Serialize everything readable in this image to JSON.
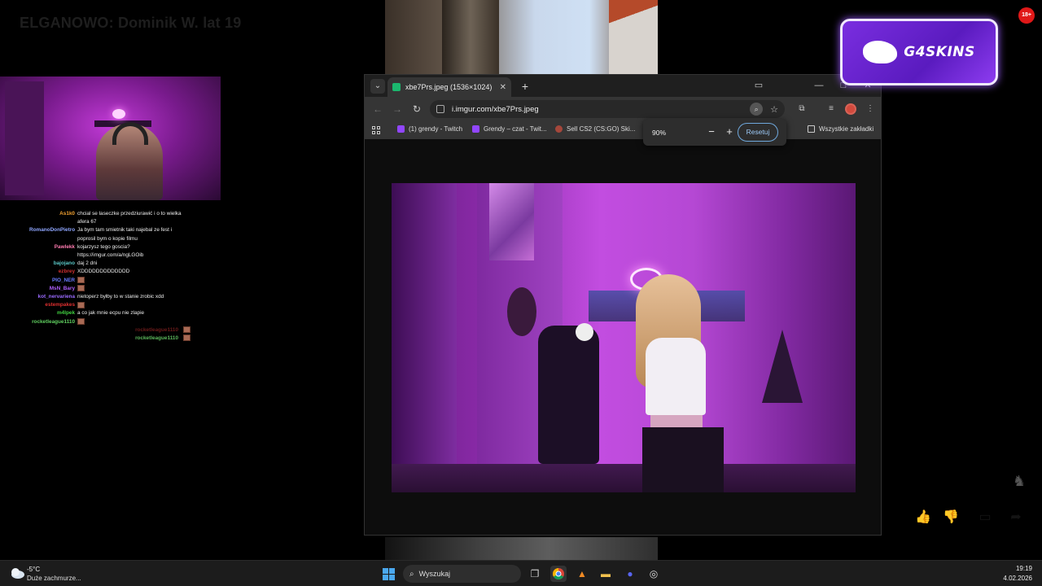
{
  "stream": {
    "title": "ELGANOWO: Dominik W. lat 19"
  },
  "chat": [
    {
      "user": "As1k0",
      "color": "#f0a030",
      "message": "chcial se laseczke przedziurawić i o to wielka afera 67"
    },
    {
      "user": "RomanoDonPietro",
      "color": "#8fa6ff",
      "message": "Ja bym tam smietnik taki najebal ze fest i poprosil bym o kopie filmu"
    },
    {
      "user": "Pawlekk",
      "color": "#ff7bb0",
      "message": "kojarzysz tego goscia? https://imgur.com/a/ngLGOib"
    },
    {
      "user": "bajojano",
      "color": "#5ac8c8",
      "message": "daj 2 dni"
    },
    {
      "user": "ezbrey",
      "color": "#d03030",
      "message": "XDDDDDDDDDDDDD"
    },
    {
      "user": "PIO_NER",
      "color": "#6a7bff",
      "message": "",
      "emote": true
    },
    {
      "user": "MsN_Bary",
      "color": "#b060ff",
      "message": "",
      "emote": true
    },
    {
      "user": "kot_nervariena",
      "color": "#9b6bff",
      "message": "nietoperz byłby to w stanie zrobic xdd"
    },
    {
      "user": "estempakes",
      "color": "#e03030",
      "message": "",
      "emote": true
    },
    {
      "user": "m4lpek",
      "color": "#40d040",
      "message": "a co jak mnie ecpu nie zlapie"
    },
    {
      "user": "rocketleague1110",
      "color": "#60d060",
      "message": "",
      "emote": true
    }
  ],
  "chat_right": [
    {
      "user": "rocketleague1110",
      "color": "#6b1a1a"
    },
    {
      "user": "rocketleague1110",
      "color": "#5cb85c"
    }
  ],
  "browser": {
    "tab_title": "xbe7Prs.jpeg (1536×1024)",
    "url": "i.imgur.com/xbe7Prs.jpeg",
    "bookmarks": [
      {
        "label": "(1) grendy - Twitch",
        "icon": "twitch-icon"
      },
      {
        "label": "Grendy – czat - Twit...",
        "icon": "twitch-icon"
      },
      {
        "label": "Sell CS2 (CS:GO) Ski...",
        "icon": "sell-icon"
      },
      {
        "label": "Wszystkie zakładki",
        "icon": "folder-icon"
      }
    ],
    "zoom": {
      "value": "90%",
      "minus": "−",
      "plus": "+",
      "reset": "Resetuj"
    }
  },
  "overlay": {
    "brand": "G4SKINS",
    "age_badge": "18+"
  },
  "taskbar": {
    "weather_temp": "-5°C",
    "weather_desc": "Duże zachmurze...",
    "search_placeholder": "Wyszukaj",
    "time": "19:19",
    "date": "4.02.2026"
  }
}
